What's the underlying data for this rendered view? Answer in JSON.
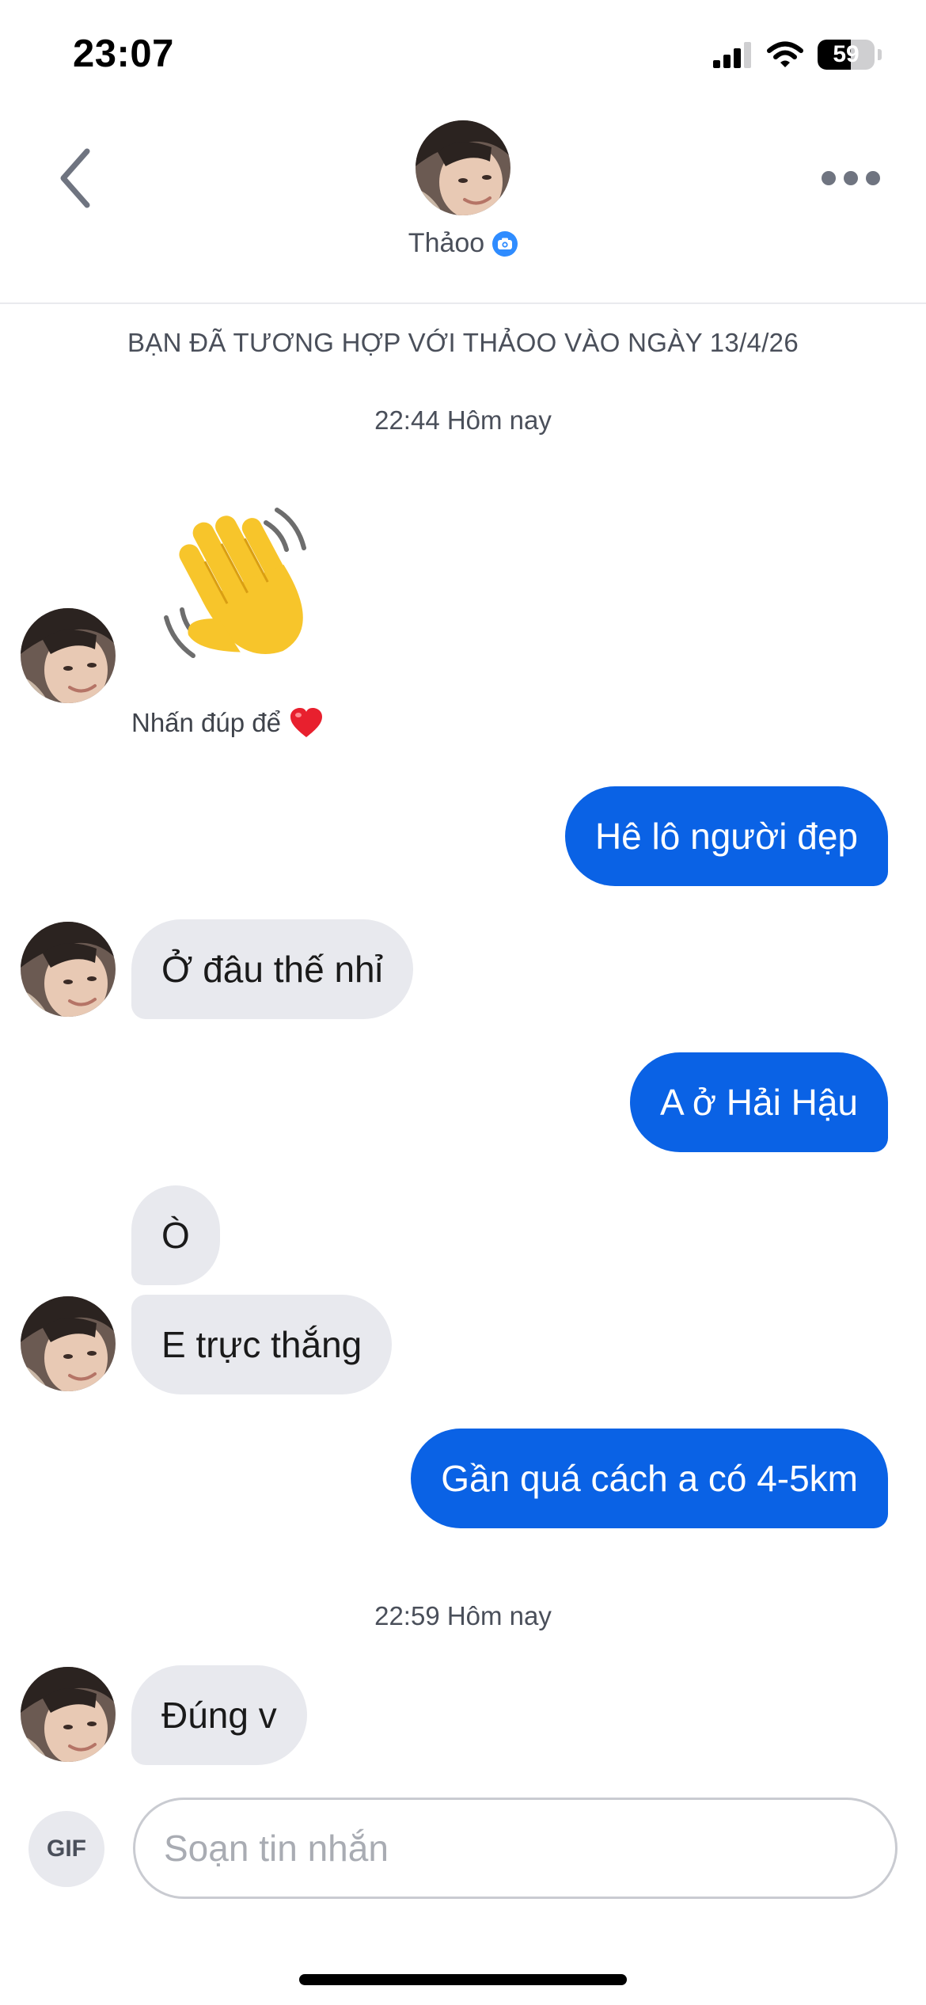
{
  "status_bar": {
    "time": "23:07",
    "battery_level": "59",
    "battery_fraction": 0.59,
    "icons": [
      "cellular-signal-icon",
      "wifi-icon",
      "battery-icon"
    ]
  },
  "header": {
    "contact_name": "Thảoo",
    "back_icon": "chevron-left-icon",
    "more_icon": "more-horizontal-icon",
    "verified_icon": "camera-verified-icon"
  },
  "conversation": {
    "match_notice": "BẠN ĐÃ TƯƠNG HỢP VỚI THẢOO VÀO NGÀY 13/4/26",
    "timestamp_1": "22:44 Hôm nay",
    "sticker_emoji": "waving-hand",
    "double_tap_hint": "Nhấn đúp để",
    "heart_icon": "red-heart",
    "messages": [
      {
        "from": "me",
        "text": "Hê lô người đẹp"
      },
      {
        "from": "them",
        "text": "Ở đâu thế nhỉ"
      },
      {
        "from": "me",
        "text": "A ở Hải Hậu"
      },
      {
        "from": "them",
        "text": "Ò"
      },
      {
        "from": "them",
        "text": "E trực thắng"
      },
      {
        "from": "me",
        "text": "Gần quá cách a có 4-5km"
      },
      {
        "from": "them",
        "text": "Đúng v"
      }
    ],
    "timestamp_2": "22:59 Hôm nay"
  },
  "composer": {
    "gif_label": "GIF",
    "placeholder": "Soạn tin nhắn"
  },
  "colors": {
    "sent_bubble": "#0a62e5",
    "received_bubble": "#e8e9ee",
    "verified_badge": "#2f8cff",
    "meta_text": "#4a4f5a"
  }
}
